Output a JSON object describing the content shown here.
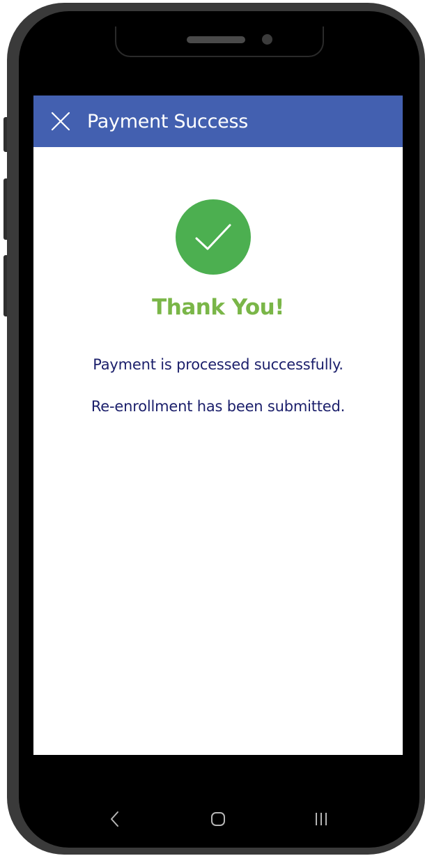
{
  "header": {
    "title": "Payment Success",
    "close_icon": "close-icon",
    "background_color": "#4360b0"
  },
  "confirmation": {
    "icon": "checkmark-icon",
    "icon_color": "#4caf50",
    "heading": "Thank You!",
    "heading_color": "#7ab648",
    "messages": [
      "Payment is processed successfully.",
      "Re-enrollment has been submitted."
    ],
    "message_color": "#1b1f6b"
  },
  "navigation": {
    "back_icon": "back-icon",
    "home_icon": "home-icon",
    "recent_apps_icon": "recent-apps-icon"
  }
}
